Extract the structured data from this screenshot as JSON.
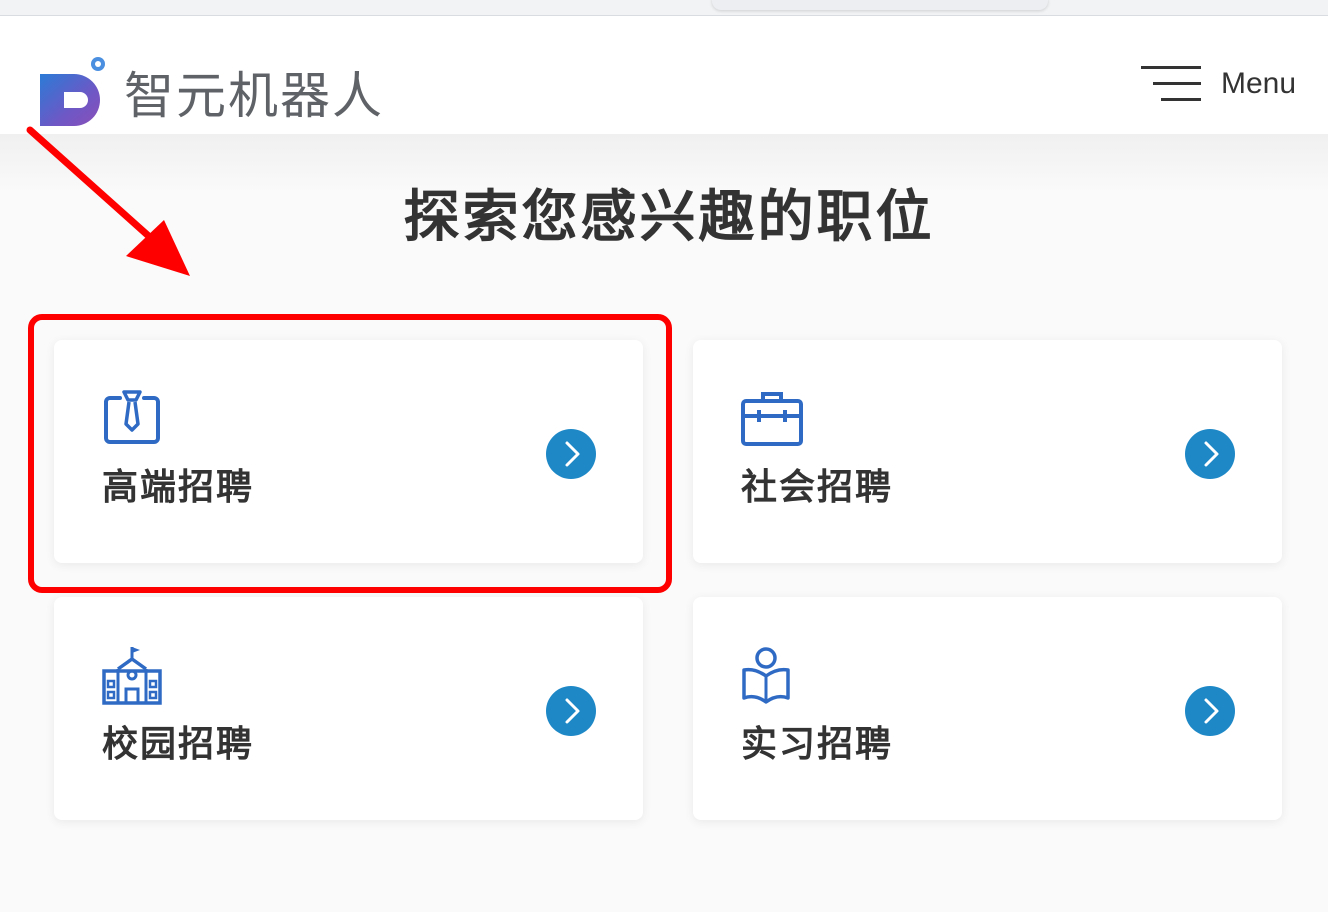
{
  "header": {
    "brand_name": "智元机器人",
    "menu_label": "Menu"
  },
  "main": {
    "title": "探索您感兴趣的职位",
    "cards": [
      {
        "label": "高端招聘",
        "icon": "tie-icon",
        "highlighted": true
      },
      {
        "label": "社会招聘",
        "icon": "briefcase-icon"
      },
      {
        "label": "校园招聘",
        "icon": "school-icon"
      },
      {
        "label": "实习招聘",
        "icon": "reading-person-icon"
      }
    ]
  },
  "colors": {
    "accent": "#1e88c7",
    "icon_blue": "#2f6bc4",
    "annotation_red": "#ff0000"
  }
}
